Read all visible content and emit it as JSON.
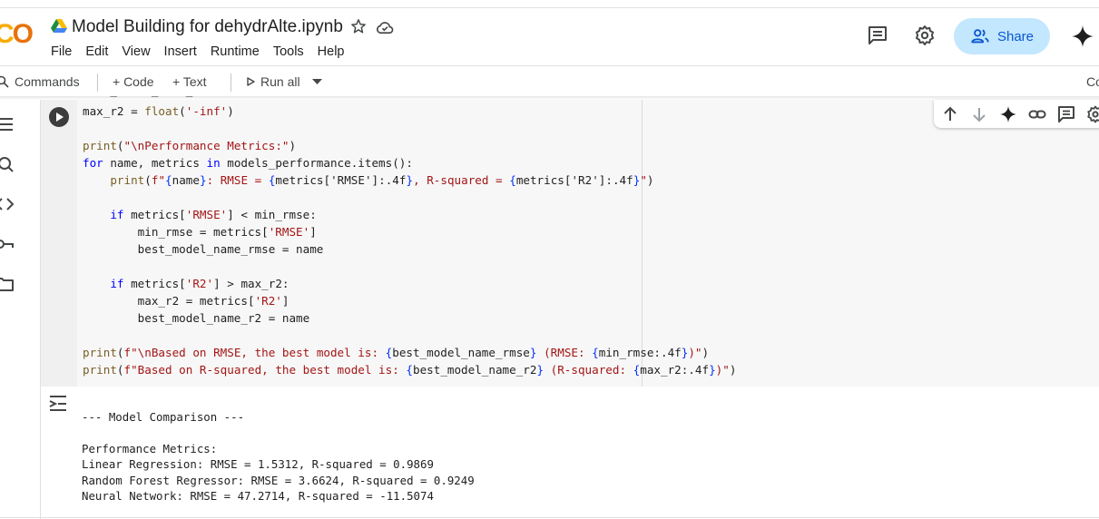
{
  "app": {
    "logo_text": "CO",
    "notebook_title": "Model Building for dehydrAlte.ipynb"
  },
  "menu": [
    "File",
    "Edit",
    "View",
    "Insert",
    "Runtime",
    "Tools",
    "Help"
  ],
  "header": {
    "share_label": "Share"
  },
  "toolbar": {
    "commands_label": "Commands",
    "code_label": "+ Code",
    "text_label": "+ Text",
    "run_all_label": "Run all",
    "right_clip": "Co"
  },
  "colors": {
    "share_bg": "#c2e7ff",
    "share_fg": "#0b57d0",
    "logo_yellow": "#f9ab00",
    "logo_orange": "#e8710a"
  },
  "code_lines": [
    "max_r2 = float('-inf')",
    "",
    "print(\"\\nPerformance Metrics:\")",
    "for name, metrics in models_performance.items():",
    "    print(f\"{name}: RMSE = {metrics['RMSE']:.4f}, R-squared = {metrics['R2']:.4f}\")",
    "",
    "    if metrics['RMSE'] < min_rmse:",
    "        min_rmse = metrics['RMSE']",
    "        best_model_name_rmse = name",
    "",
    "    if metrics['R2'] > max_r2:",
    "        max_r2 = metrics['R2']",
    "        best_model_name_r2 = name",
    "",
    "print(f\"\\nBased on RMSE, the best model is: {best_model_name_rmse} (RMSE: {min_rmse:.4f})\")",
    "print(f\"Based on R-squared, the best model is: {best_model_name_r2} (R-squared: {max_r2:.4f})\")"
  ],
  "output_lines": [
    "--- Model Comparison ---",
    "",
    "Performance Metrics:",
    "Linear Regression: RMSE = 1.5312, R-squared = 0.9869",
    "Random Forest Regressor: RMSE = 3.6624, R-squared = 0.9249",
    "Neural Network: RMSE = 47.2714, R-squared = -11.5074"
  ]
}
